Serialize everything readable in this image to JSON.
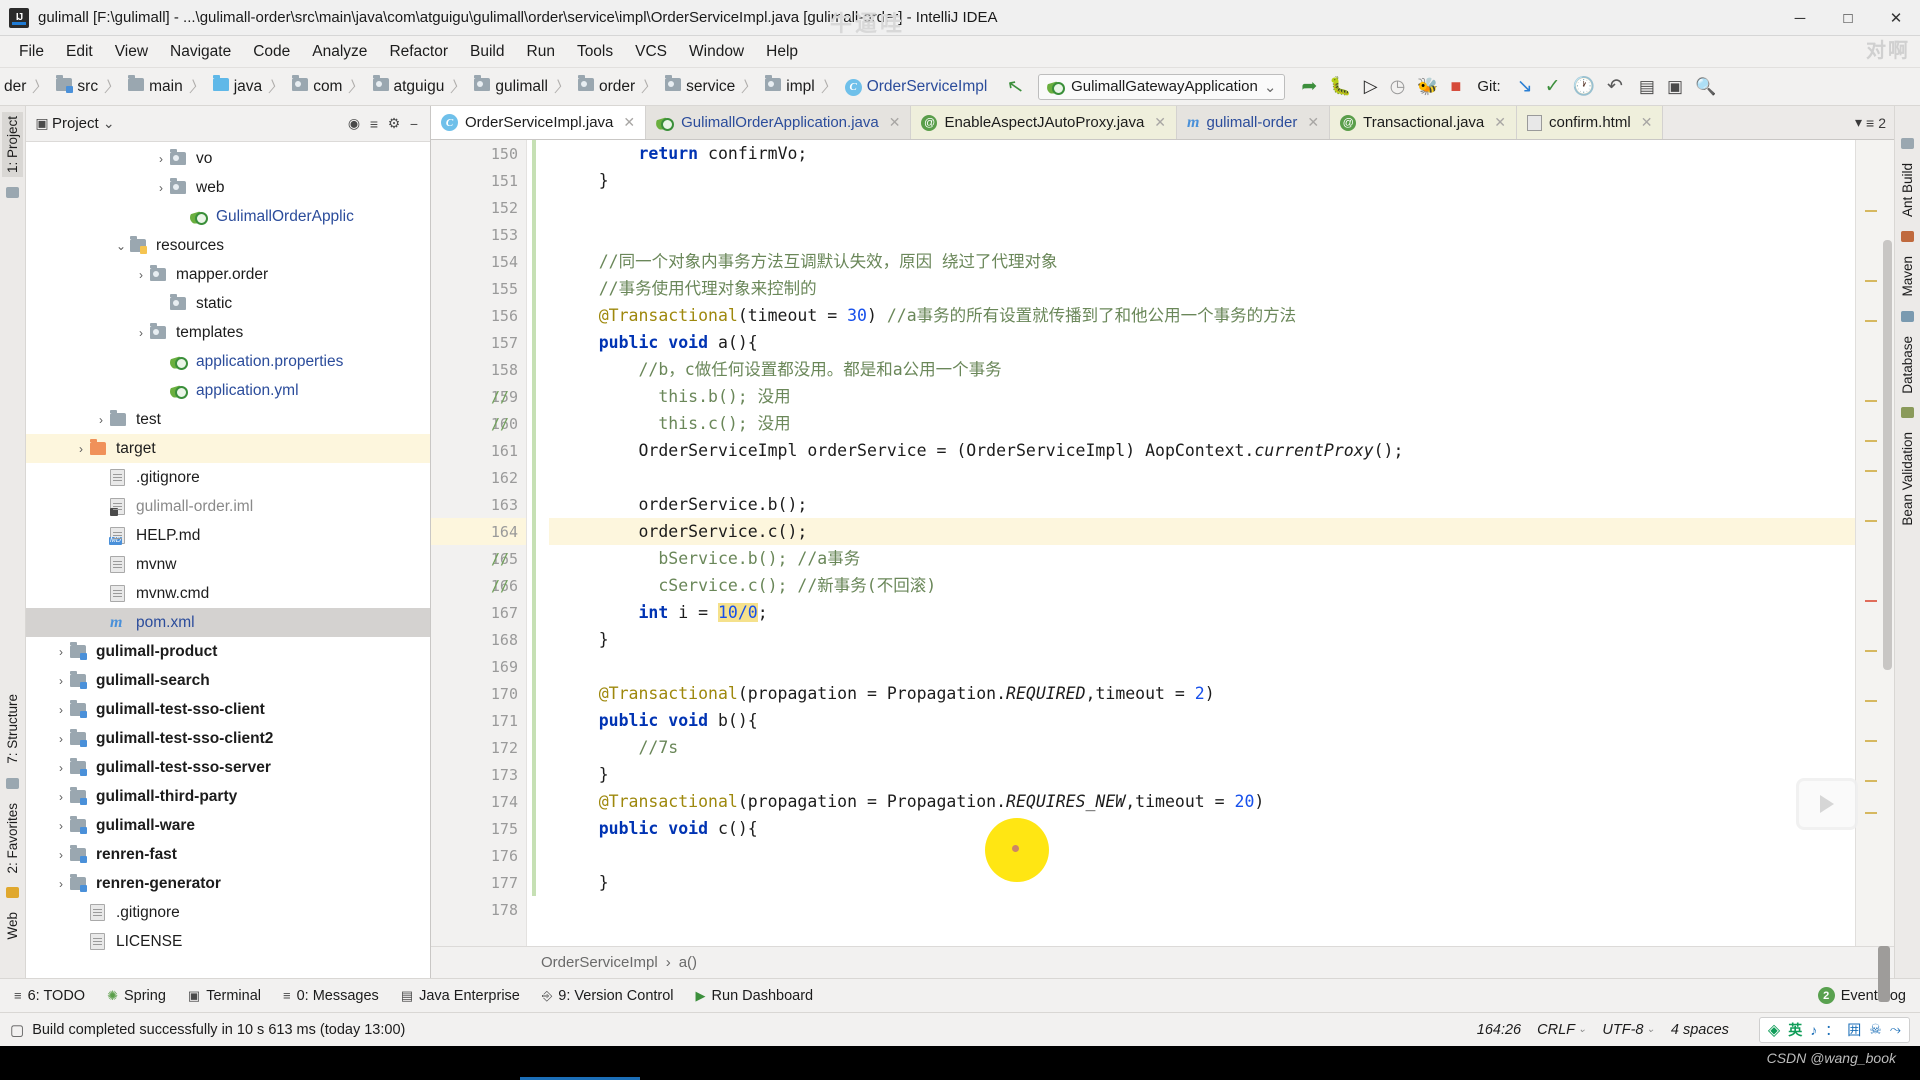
{
  "window": {
    "title": "gulimall [F:\\gulimall] - ...\\gulimall-order\\src\\main\\java\\com\\atguigu\\gulimall\\order\\service\\impl\\OrderServiceImpl.java [gulimall-order] - IntelliJ IDEA",
    "minimize": "─",
    "maximize": "□",
    "close": "✕",
    "logo_text": "IJ"
  },
  "menubar": {
    "items": [
      "File",
      "Edit",
      "View",
      "Navigate",
      "Code",
      "Analyze",
      "Refactor",
      "Build",
      "Run",
      "Tools",
      "VCS",
      "Window",
      "Help"
    ]
  },
  "navbar": {
    "crumbs": [
      {
        "label": "der",
        "icon": "truncated-crumb"
      },
      {
        "label": "src",
        "icon": "folder-icon"
      },
      {
        "label": "main",
        "icon": "folder-icon"
      },
      {
        "label": "java",
        "icon": "folder-blue-icon"
      },
      {
        "label": "com",
        "icon": "package-icon"
      },
      {
        "label": "atguigu",
        "icon": "package-icon"
      },
      {
        "label": "gulimall",
        "icon": "package-icon"
      },
      {
        "label": "order",
        "icon": "package-icon"
      },
      {
        "label": "service",
        "icon": "package-icon"
      },
      {
        "label": "impl",
        "icon": "package-icon"
      },
      {
        "label": "OrderServiceImpl",
        "icon": "class-icon"
      }
    ],
    "separator": "〉",
    "run_config": "GulimallGatewayApplication",
    "run_config_caret": "⌄",
    "git_label": "Git:",
    "toolbar_icons": [
      "run-icon",
      "debug-icon",
      "run-with-coverage-icon",
      "profiler-icon",
      "attach-debugger-icon",
      "stop-icon",
      "update-project-icon",
      "commit-icon",
      "history-icon",
      "rollback-icon",
      "settings-icon",
      "window-icon",
      "search-icon"
    ]
  },
  "tool_strips": {
    "left": [
      {
        "label": "1: Project",
        "selected": true
      },
      {
        "label": "7: Structure",
        "selected": false
      },
      {
        "label": "2: Favorites",
        "selected": false
      },
      {
        "label": "Web",
        "selected": false
      }
    ],
    "right": [
      {
        "label": "Ant Build"
      },
      {
        "label": "Maven"
      },
      {
        "label": "Database"
      },
      {
        "label": "Bean Validation"
      }
    ]
  },
  "project_panel": {
    "title": "Project",
    "title_caret": "⌄",
    "header_icons": [
      "locate-icon",
      "collapse-all-icon",
      "gear-icon",
      "hide-icon"
    ],
    "tree": [
      {
        "label": "vo",
        "indent": 6,
        "twist": "›",
        "icon": "package-icon",
        "style": "normal"
      },
      {
        "label": "web",
        "indent": 6,
        "twist": "›",
        "icon": "package-icon",
        "style": "normal"
      },
      {
        "label": "GulimallOrderApplic",
        "indent": 7,
        "twist": "",
        "icon": "spring-class-icon",
        "style": "blue"
      },
      {
        "label": "resources",
        "indent": 4,
        "twist": "⌄",
        "icon": "resources-folder-icon",
        "style": "normal"
      },
      {
        "label": "mapper.order",
        "indent": 5,
        "twist": "›",
        "icon": "package-icon",
        "style": "normal"
      },
      {
        "label": "static",
        "indent": 6,
        "twist": "",
        "icon": "package-icon",
        "style": "normal"
      },
      {
        "label": "templates",
        "indent": 5,
        "twist": "›",
        "icon": "package-icon",
        "style": "normal"
      },
      {
        "label": "application.properties",
        "indent": 6,
        "twist": "",
        "icon": "spring-config-icon",
        "style": "blue"
      },
      {
        "label": "application.yml",
        "indent": 6,
        "twist": "",
        "icon": "spring-config-icon",
        "style": "blue"
      },
      {
        "label": "test",
        "indent": 3,
        "twist": "›",
        "icon": "folder-icon",
        "style": "normal"
      },
      {
        "label": "target",
        "indent": 2,
        "twist": "›",
        "icon": "folder-orange-icon",
        "style": "normal",
        "row": "highlight"
      },
      {
        "label": ".gitignore",
        "indent": 3,
        "twist": "",
        "icon": "file-icon",
        "style": "normal"
      },
      {
        "label": "gulimall-order.iml",
        "indent": 3,
        "twist": "",
        "icon": "iml-file-icon",
        "style": "gray"
      },
      {
        "label": "HELP.md",
        "indent": 3,
        "twist": "",
        "icon": "markdown-file-icon",
        "style": "normal"
      },
      {
        "label": "mvnw",
        "indent": 3,
        "twist": "",
        "icon": "file-icon",
        "style": "normal"
      },
      {
        "label": "mvnw.cmd",
        "indent": 3,
        "twist": "",
        "icon": "file-icon",
        "style": "normal"
      },
      {
        "label": "pom.xml",
        "indent": 3,
        "twist": "",
        "icon": "maven-file-icon",
        "style": "blue",
        "row": "selected"
      },
      {
        "label": "gulimall-product",
        "indent": 1,
        "twist": "›",
        "icon": "module-folder-icon",
        "style": "bold"
      },
      {
        "label": "gulimall-search",
        "indent": 1,
        "twist": "›",
        "icon": "module-folder-icon",
        "style": "bold"
      },
      {
        "label": "gulimall-test-sso-client",
        "indent": 1,
        "twist": "›",
        "icon": "module-folder-icon",
        "style": "bold"
      },
      {
        "label": "gulimall-test-sso-client2",
        "indent": 1,
        "twist": "›",
        "icon": "module-folder-icon",
        "style": "bold"
      },
      {
        "label": "gulimall-test-sso-server",
        "indent": 1,
        "twist": "›",
        "icon": "module-folder-icon",
        "style": "bold"
      },
      {
        "label": "gulimall-third-party",
        "indent": 1,
        "twist": "›",
        "icon": "module-folder-icon",
        "style": "bold"
      },
      {
        "label": "gulimall-ware",
        "indent": 1,
        "twist": "›",
        "icon": "module-folder-icon",
        "style": "bold"
      },
      {
        "label": "renren-fast",
        "indent": 1,
        "twist": "›",
        "icon": "module-folder-icon",
        "style": "bold"
      },
      {
        "label": "renren-generator",
        "indent": 1,
        "twist": "›",
        "icon": "module-folder-icon",
        "style": "bold"
      },
      {
        "label": ".gitignore",
        "indent": 2,
        "twist": "",
        "icon": "file-icon",
        "style": "normal"
      },
      {
        "label": "LICENSE",
        "indent": 2,
        "twist": "",
        "icon": "file-icon",
        "style": "normal"
      }
    ]
  },
  "editor_tabs": [
    {
      "label": "OrderServiceImpl.java",
      "icon": "java-class-icon",
      "state": "active",
      "close": "✕"
    },
    {
      "label": "GulimallOrderApplication.java",
      "icon": "spring-class-icon",
      "state": "blue",
      "close": "✕"
    },
    {
      "label": "EnableAspectJAutoProxy.java",
      "icon": "annotation-icon",
      "state": "olive",
      "close": "✕"
    },
    {
      "label": "gulimall-order",
      "icon": "maven-file-icon",
      "state": "blue",
      "close": "✕"
    },
    {
      "label": "Transactional.java",
      "icon": "annotation-icon",
      "state": "olive",
      "close": "✕"
    },
    {
      "label": "confirm.html",
      "icon": "html-file-icon",
      "state": "olive",
      "close": "✕"
    }
  ],
  "editor_tabs_extra": {
    "label": "2",
    "caret": "▾",
    "list_icon": "tab-list-icon"
  },
  "editor": {
    "first_line": 150,
    "current_line": 164,
    "lines": [
      {
        "n": 150,
        "fold": false,
        "tokens": [
          {
            "t": "        ",
            "c": "id"
          },
          {
            "t": "return",
            "c": "kw"
          },
          {
            "t": " confirmVo;",
            "c": "id"
          }
        ]
      },
      {
        "n": 151,
        "fold": true,
        "tokens": [
          {
            "t": "    }",
            "c": "id"
          }
        ]
      },
      {
        "n": 152,
        "fold": false,
        "tokens": []
      },
      {
        "n": 153,
        "fold": false,
        "tokens": []
      },
      {
        "n": 154,
        "fold": true,
        "tokens": [
          {
            "t": "    //同一个对象内事务方法互调默认失效，原因 绕过了代理对象",
            "c": "cmtc"
          }
        ]
      },
      {
        "n": 155,
        "fold": true,
        "tokens": [
          {
            "t": "    //事务使用代理对象来控制的",
            "c": "cmtc"
          }
        ]
      },
      {
        "n": 156,
        "fold": false,
        "tokens": [
          {
            "t": "    @Transactional",
            "c": "ann"
          },
          {
            "t": "(timeout = ",
            "c": "id"
          },
          {
            "t": "30",
            "c": "num"
          },
          {
            "t": ") ",
            "c": "id"
          },
          {
            "t": "//a事务的所有设置就传播到了和他公用一个事务的方法",
            "c": "cmtc"
          }
        ]
      },
      {
        "n": 157,
        "fold": true,
        "tokens": [
          {
            "t": "    public void ",
            "c": "kw"
          },
          {
            "t": "a(){",
            "c": "id"
          }
        ]
      },
      {
        "n": 158,
        "fold": true,
        "tokens": [
          {
            "t": "        //b，c做任何设置都没用。都是和a公用一个事务",
            "c": "cmtc"
          }
        ]
      },
      {
        "n": 159,
        "fold": false,
        "comment_gutter": "//",
        "tokens": [
          {
            "t": "          this.b(); 没用",
            "c": "cmtc"
          }
        ]
      },
      {
        "n": 160,
        "fold": true,
        "comment_gutter": "//",
        "tokens": [
          {
            "t": "          this.c(); 没用",
            "c": "cmtc"
          }
        ]
      },
      {
        "n": 161,
        "fold": false,
        "tokens": [
          {
            "t": "        OrderServiceImpl orderService = (OrderServiceImpl) AopContext.",
            "c": "id"
          },
          {
            "t": "currentProxy",
            "c": "itid"
          },
          {
            "t": "();",
            "c": "id"
          }
        ]
      },
      {
        "n": 162,
        "fold": false,
        "tokens": []
      },
      {
        "n": 163,
        "fold": false,
        "tokens": [
          {
            "t": "        orderService.b();",
            "c": "id"
          }
        ]
      },
      {
        "n": 164,
        "fold": false,
        "current": true,
        "tokens": [
          {
            "t": "        orderService.c();",
            "c": "id"
          }
        ]
      },
      {
        "n": 165,
        "fold": true,
        "comment_gutter": "//",
        "tokens": [
          {
            "t": "          bService.b(); //a事务",
            "c": "cmtc"
          }
        ]
      },
      {
        "n": 166,
        "fold": true,
        "comment_gutter": "//",
        "tokens": [
          {
            "t": "          cService.c(); //新事务(不回滚)",
            "c": "cmtc"
          }
        ]
      },
      {
        "n": 167,
        "fold": false,
        "tokens": [
          {
            "t": "        int",
            "c": "kw"
          },
          {
            "t": " i = ",
            "c": "id"
          },
          {
            "t": "10/0",
            "c": "numhl"
          },
          {
            "t": ";",
            "c": "id"
          }
        ]
      },
      {
        "n": 168,
        "fold": true,
        "tokens": [
          {
            "t": "    }",
            "c": "id"
          }
        ]
      },
      {
        "n": 169,
        "fold": false,
        "tokens": []
      },
      {
        "n": 170,
        "fold": false,
        "tokens": [
          {
            "t": "    @Transactional",
            "c": "ann"
          },
          {
            "t": "(propagation = Propagation.",
            "c": "id"
          },
          {
            "t": "REQUIRED",
            "c": "itid"
          },
          {
            "t": ",timeout = ",
            "c": "id"
          },
          {
            "t": "2",
            "c": "num"
          },
          {
            "t": ")",
            "c": "id"
          }
        ]
      },
      {
        "n": 171,
        "fold": true,
        "tokens": [
          {
            "t": "    public void ",
            "c": "kw"
          },
          {
            "t": "b(){",
            "c": "id"
          }
        ]
      },
      {
        "n": 172,
        "fold": false,
        "tokens": [
          {
            "t": "        //7s",
            "c": "cmtc"
          }
        ]
      },
      {
        "n": 173,
        "fold": true,
        "tokens": [
          {
            "t": "    }",
            "c": "id"
          }
        ]
      },
      {
        "n": 174,
        "fold": false,
        "tokens": [
          {
            "t": "    @Transactional",
            "c": "ann"
          },
          {
            "t": "(propagation = Propagation.",
            "c": "id"
          },
          {
            "t": "REQUIRES_NEW",
            "c": "itid"
          },
          {
            "t": ",timeout = ",
            "c": "id"
          },
          {
            "t": "20",
            "c": "num"
          },
          {
            "t": ")",
            "c": "id"
          }
        ]
      },
      {
        "n": 175,
        "fold": true,
        "tokens": [
          {
            "t": "    public void ",
            "c": "kw"
          },
          {
            "t": "c(){",
            "c": "id"
          }
        ]
      },
      {
        "n": 176,
        "fold": false,
        "tokens": []
      },
      {
        "n": 177,
        "fold": false,
        "tokens": [
          {
            "t": "    }",
            "c": "id"
          }
        ]
      },
      {
        "n": 178,
        "fold": false,
        "tokens": []
      }
    ],
    "breadcrumb": [
      "OrderServiceImpl",
      "a()"
    ],
    "breadcrumb_sep": "›"
  },
  "bottom_toolwindows": [
    {
      "label": "6: TODO",
      "icon": "todo-icon"
    },
    {
      "label": "Spring",
      "icon": "spring-icon"
    },
    {
      "label": "Terminal",
      "icon": "terminal-icon"
    },
    {
      "label": "0: Messages",
      "icon": "messages-icon"
    },
    {
      "label": "Java Enterprise",
      "icon": "java-enterprise-icon"
    },
    {
      "label": "9: Version Control",
      "icon": "version-control-icon"
    },
    {
      "label": "Run Dashboard",
      "icon": "run-dashboard-icon"
    }
  ],
  "event_log": {
    "label": "Event Log",
    "badge": "2"
  },
  "statusbar": {
    "message": "Build completed successfully in 10 s 613 ms (today 13:00)",
    "message_icon": "build-icon",
    "caret_position": "164:26",
    "line_separator": "CRLF",
    "encoding": "UTF-8",
    "indent": "4 spaces",
    "chevron": "⌄",
    "ime": [
      "英",
      "♪",
      "：",
      "囲",
      "☠",
      "⤳"
    ]
  },
  "watermarks": {
    "top": "牛逼哇",
    "right": "对啊",
    "csdn": "CSDN @wang_book"
  },
  "colors": {
    "accent_blue": "#2b4c9b",
    "keyword": "#0033b3",
    "annotation": "#9e880d",
    "comment": "#70a05a",
    "number": "#1750eb",
    "highlight_row": "#fdf6dd",
    "selected_row": "#d4d2d0",
    "cursor_dot": "#ffe400"
  }
}
